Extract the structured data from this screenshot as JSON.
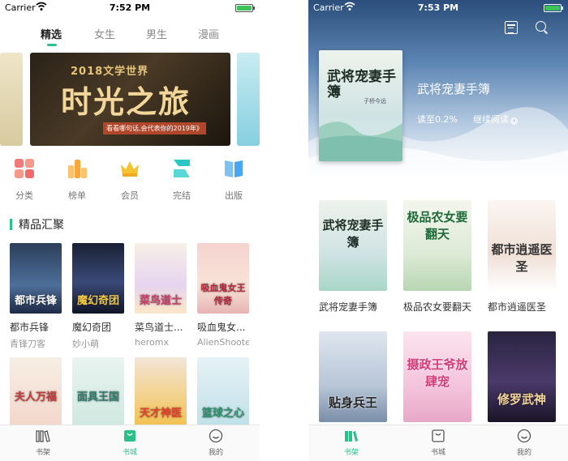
{
  "left": {
    "status": {
      "carrier": "Carrier",
      "time": "7:52 PM",
      "battery_level": 1.0,
      "battery_color": "#3cc45a"
    },
    "tabs": [
      {
        "label": "精选",
        "active": true
      },
      {
        "label": "女生",
        "active": false
      },
      {
        "label": "男生",
        "active": false
      },
      {
        "label": "漫画",
        "active": false
      }
    ],
    "banner": {
      "line1": "2018文学世界",
      "line2": "时光之旅",
      "line3": "看看哪句话,会代表你的2019年》"
    },
    "categories": [
      {
        "label": "分类",
        "icon": "grid-icon",
        "color": "#f06b6b"
      },
      {
        "label": "榜单",
        "icon": "bar-chart-icon",
        "color": "#f6a83c"
      },
      {
        "label": "会员",
        "icon": "crown-icon",
        "color": "#f5c230"
      },
      {
        "label": "完结",
        "icon": "stack-icon",
        "color": "#2bc6c6"
      },
      {
        "label": "出版",
        "icon": "book-icon",
        "color": "#4aa6f0"
      }
    ],
    "section_title": "精品汇聚",
    "books": [
      {
        "title": "都市兵锋",
        "author": "青锋刀客",
        "cover_text": "都市兵锋"
      },
      {
        "title": "魔幻奇团",
        "author": "妙小萌",
        "cover_text": "魔幻奇团"
      },
      {
        "title": "菜鸟道士...",
        "author": "heromx",
        "cover_text": "菜鸟道士"
      },
      {
        "title": "吸血鬼女...",
        "author": "AlienShooter",
        "cover_text": "吸血鬼女王传奇"
      },
      {
        "title": "",
        "author": "",
        "cover_text": "夫人万福"
      },
      {
        "title": "",
        "author": "",
        "cover_text": "面具王国"
      },
      {
        "title": "",
        "author": "",
        "cover_text": "天才神医"
      },
      {
        "title": "",
        "author": "",
        "cover_text": "篮球之心"
      }
    ],
    "tabbar": [
      {
        "label": "书架",
        "icon": "shelf-icon",
        "active": false
      },
      {
        "label": "书城",
        "icon": "store-bag-icon",
        "active": true
      },
      {
        "label": "我的",
        "icon": "smile-icon",
        "active": false
      }
    ]
  },
  "right": {
    "status": {
      "carrier": "Carrier",
      "time": "7:53 PM",
      "battery_level": 1.0,
      "battery_color": "#3cc45a"
    },
    "hero": {
      "title": "武将宠妻手簿",
      "progress": "读至0.2%",
      "continue_label": "继续阅读",
      "cover_text": "武将宠妻手簿",
      "cover_author": "子桥今远"
    },
    "books": [
      {
        "title": "武将宠妻手簿",
        "cover_text": "武将宠妻手簿"
      },
      {
        "title": "极品农女要翻天",
        "cover_text": "极品农女要翻天"
      },
      {
        "title": "都市逍遥医圣",
        "cover_text": "都市逍遥医圣"
      },
      {
        "title": "",
        "cover_text": "贴身兵王"
      },
      {
        "title": "",
        "cover_text": "摄政王爷放肆宠"
      },
      {
        "title": "",
        "cover_text": "修罗武神"
      }
    ],
    "tabbar": [
      {
        "label": "书架",
        "icon": "shelf-icon",
        "active": true
      },
      {
        "label": "书城",
        "icon": "store-bag-icon",
        "active": false
      },
      {
        "label": "我的",
        "icon": "smile-icon",
        "active": false
      }
    ]
  }
}
